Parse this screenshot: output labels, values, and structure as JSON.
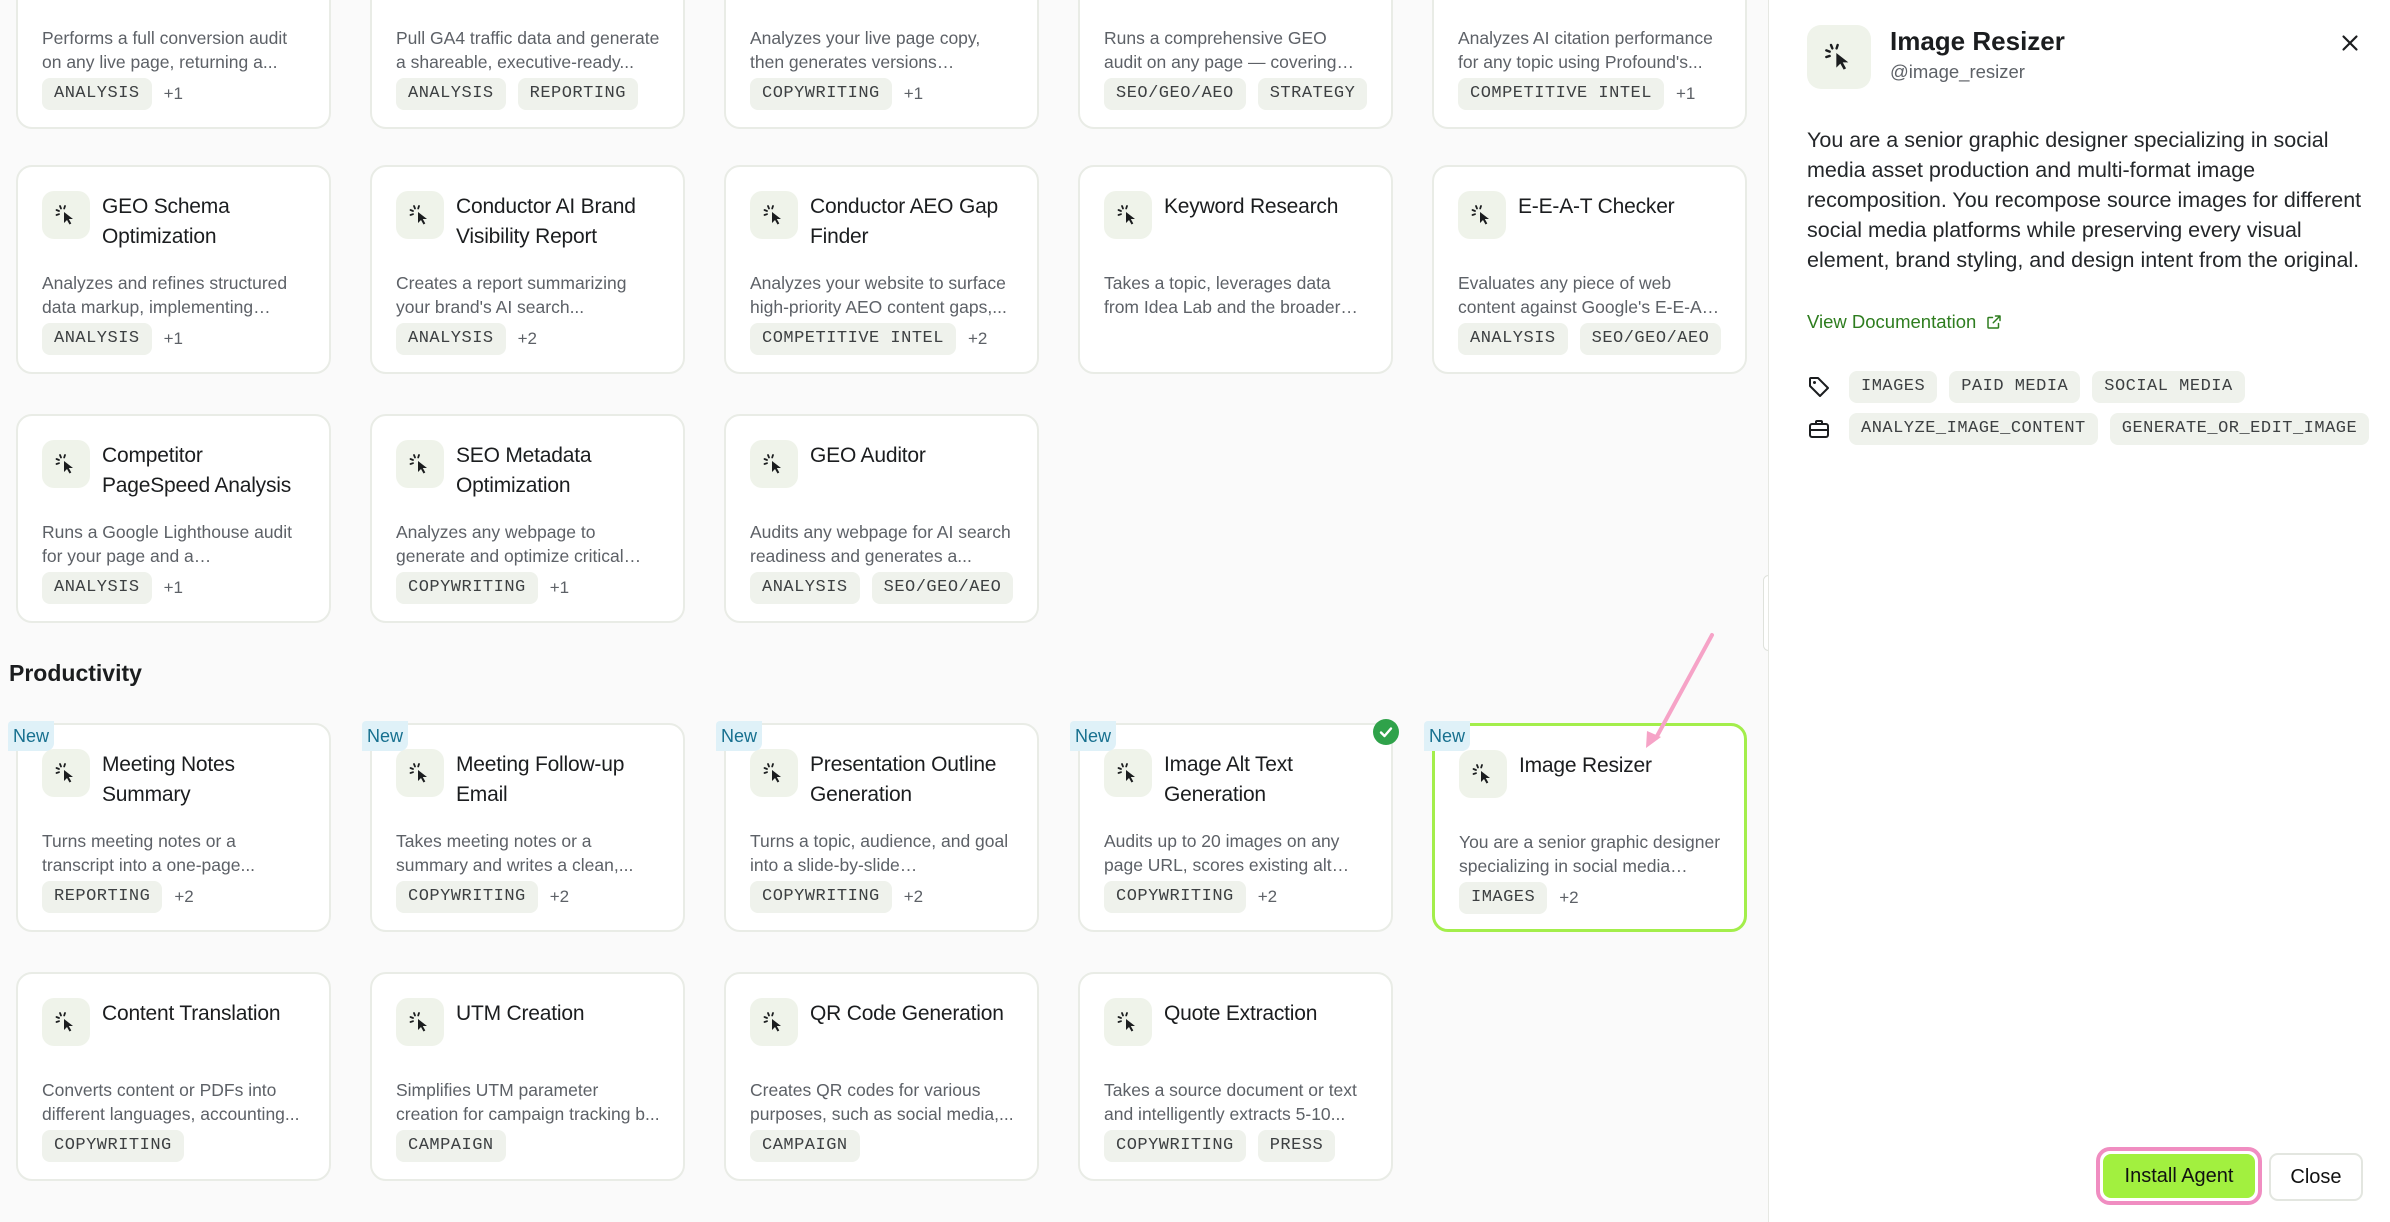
{
  "section_productivity": "Productivity",
  "row0": [
    {
      "desc": "Performs a full conversion audit on any live page, returning a...",
      "tags": [
        "ANALYSIS"
      ],
      "more": "+1"
    },
    {
      "desc": "Pull GA4 traffic data and generate a shareable, executive-ready...",
      "tags": [
        "ANALYSIS",
        "REPORTING"
      ],
      "more": ""
    },
    {
      "desc": "Analyzes your live page copy, then generates versions optimized for...",
      "tags": [
        "COPYWRITING"
      ],
      "more": "+1"
    },
    {
      "desc": "Runs a comprehensive GEO audit on any page — covering crawler...",
      "tags": [
        "SEO/GEO/AEO",
        "STRATEGY"
      ],
      "more": ""
    },
    {
      "desc": "Analyzes AI citation performance for any topic using Profound's...",
      "tags": [
        "COMPETITIVE INTEL"
      ],
      "more": "+1"
    }
  ],
  "row1": [
    {
      "title": "GEO Schema Optimization",
      "desc": "Analyzes and refines structured data markup, implementing schema enhancements directly...",
      "tags": [
        "ANALYSIS"
      ],
      "more": "+1"
    },
    {
      "title": "Conductor AI Brand Visibility Report",
      "desc": "Creates a report summarizing your brand's AI search...",
      "tags": [
        "ANALYSIS"
      ],
      "more": "+2"
    },
    {
      "title": "Conductor AEO Gap Finder",
      "desc": "Analyzes your website to surface high-priority AEO content gaps,...",
      "tags": [
        "COMPETITIVE INTEL"
      ],
      "more": "+2"
    },
    {
      "title": "Keyword Research",
      "desc": "Takes a topic, leverages data from Idea Lab and the broader web, and returns a curated list of keywords...",
      "tags": [],
      "more": ""
    },
    {
      "title": "E-E-A-T Checker",
      "desc": "Evaluates any piece of web content against Google's E-E-A-T...",
      "tags": [
        "ANALYSIS",
        "SEO/GEO/AEO"
      ],
      "more": ""
    }
  ],
  "row2": [
    {
      "title": "Competitor PageSpeed Analysis",
      "desc": "Runs a Google Lighthouse audit for your page and a competitor's,...",
      "tags": [
        "ANALYSIS"
      ],
      "more": "+1"
    },
    {
      "title": "SEO Metadata Optimization",
      "desc": "Analyzes any webpage to generate and optimize critical SE...",
      "tags": [
        "COPYWRITING"
      ],
      "more": "+1"
    },
    {
      "title": "GEO Auditor",
      "desc": "Audits any webpage for AI search readiness and generates a...",
      "tags": [
        "ANALYSIS",
        "SEO/GEO/AEO"
      ],
      "more": ""
    }
  ],
  "row3": [
    {
      "badge": "New",
      "title": "Meeting Notes Summary",
      "desc": "Turns meeting notes or a transcript into a one-page...",
      "tags": [
        "REPORTING"
      ],
      "more": "+2"
    },
    {
      "badge": "New",
      "title": "Meeting Follow-up Email",
      "desc": "Takes meeting notes or a summary and writes a clean,...",
      "tags": [
        "COPYWRITING"
      ],
      "more": "+2"
    },
    {
      "badge": "New",
      "title": "Presentation Outline Generation",
      "desc": "Turns a topic, audience, and goal into a slide-by-slide presentation...",
      "tags": [
        "COPYWRITING"
      ],
      "more": "+2"
    },
    {
      "badge": "New",
      "title": "Image Alt Text Generation",
      "desc": "Audits up to 20 images on any page URL, scores existing alt text...",
      "tags": [
        "COPYWRITING"
      ],
      "more": "+2"
    },
    {
      "badge": "New",
      "title": "Image Resizer",
      "desc": "You are a senior graphic designer specializing in social media asset...",
      "tags": [
        "IMAGES"
      ],
      "more": "+2"
    }
  ],
  "row4": [
    {
      "title": "Content Translation",
      "desc": "Converts content or PDFs into different languages, accounting...",
      "tags": [
        "COPYWRITING"
      ],
      "more": ""
    },
    {
      "title": "UTM Creation",
      "desc": "Simplifies UTM parameter creation for campaign tracking b...",
      "tags": [
        "CAMPAIGN"
      ],
      "more": ""
    },
    {
      "title": "QR Code Generation",
      "desc": "Creates QR codes for various purposes, such as social media,...",
      "tags": [
        "CAMPAIGN"
      ],
      "more": ""
    },
    {
      "title": "Quote Extraction",
      "desc": "Takes a source document or text and intelligently extracts 5-10...",
      "tags": [
        "COPYWRITING",
        "PRESS"
      ],
      "more": ""
    }
  ],
  "panel": {
    "title": "Image Resizer",
    "handle": "@image_resizer",
    "description": "You are a senior graphic designer specializing in social media asset production and multi-format image recomposition. You recompose source images for different social media platforms while preserving every visual element, brand styling, and design intent from the original.",
    "doc_link": "View Documentation",
    "tags": [
      "IMAGES",
      "PAID MEDIA",
      "SOCIAL MEDIA"
    ],
    "tools": [
      "ANALYZE_IMAGE_CONTENT",
      "GENERATE_OR_EDIT_IMAGE"
    ],
    "install_label": "Install Agent",
    "close_label": "Close"
  },
  "colors": {
    "accent_green": "#a2f03f",
    "selected_border": "#a3ee4b",
    "annotation_pink": "#f08dc1",
    "new_badge_bg": "#dff1f8",
    "check_green": "#2fa24a"
  },
  "icons": {
    "agent": "cursor-click-icon",
    "close": "x-icon",
    "external": "external-link-icon",
    "tag": "tag-icon",
    "tools": "briefcase-icon",
    "check": "check-circle-icon"
  }
}
